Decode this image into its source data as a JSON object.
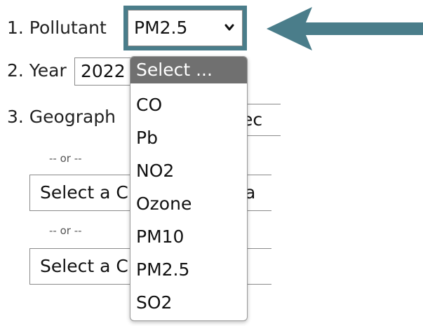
{
  "form": {
    "pollutant": {
      "label": "1. Pollutant",
      "value": "PM2.5"
    },
    "year": {
      "label": "2. Year",
      "value": "2022"
    },
    "geography": {
      "label": "3. Geograph",
      "partial_select_text": "ec"
    },
    "or_separator": "-- or --",
    "select_a_1": "Select a C",
    "select_a_1_tail": "a",
    "select_a_2": "Select a C"
  },
  "dropdown": {
    "options": [
      "Select ...",
      "CO",
      "Pb",
      "NO2",
      "Ozone",
      "PM10",
      "PM2.5",
      "SO2"
    ],
    "highlighted": "Select ..."
  },
  "colors": {
    "arrow": "#4a7d8a",
    "highlight_border": "#4a7d8a",
    "highlighted_option_bg": "#707070"
  },
  "icons": {
    "arrow": "left-arrow-icon",
    "select_chevron": "chevron-down-icon"
  }
}
